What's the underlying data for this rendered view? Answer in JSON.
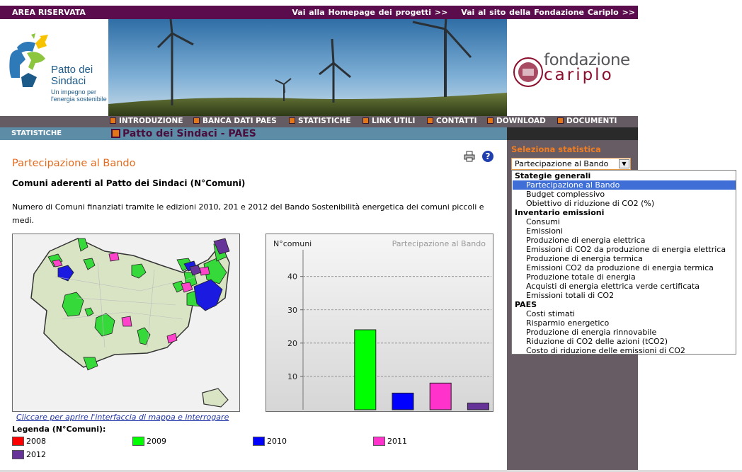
{
  "topbar": {
    "area_label": "AREA RISERVATA",
    "link_home": "Vai alla Homepage dei progetti >>",
    "link_site": "Vai al sito della Fondazione Cariplo >>"
  },
  "logos": {
    "left_name1": "Patto dei",
    "left_name2": "Sindaci",
    "left_tag1": "Un impegno per",
    "left_tag2": "l'energia sostenibile",
    "right_name1": "fondazione",
    "right_name2": "cariplo"
  },
  "nav": {
    "items": [
      "INTRODUZIONE",
      "BANCA DATI PAES",
      "STATISTICHE",
      "LINK UTILI",
      "CONTATTI",
      "DOWNLOAD",
      "DOCUMENTI"
    ]
  },
  "subbar": {
    "section": "STATISTICHE",
    "page_title": "Patto dei Sindaci - PAES"
  },
  "main": {
    "title": "Partecipazione al Bando",
    "subtitle": "Comuni aderenti al Patto dei Sindaci (N°Comuni)",
    "description": "Numero di Comuni finanziati tramite le edizioni 2010, 201 e 2012 del Bando Sostenibilità energetica dei comuni piccoli e medi.",
    "map_link": "Cliccare per aprire l'interfaccia di mappa e interrogare",
    "legend_title": "Legenda (N°Comuni):",
    "legend": [
      {
        "label": "2008",
        "color": "#ff0000"
      },
      {
        "label": "2009",
        "color": "#00ff00"
      },
      {
        "label": "2010",
        "color": "#0000ff"
      },
      {
        "label": "2011",
        "color": "#ff33cc"
      },
      {
        "label": "2012",
        "color": "#663399"
      }
    ]
  },
  "sidebar": {
    "title": "Seleziona statistica",
    "selected": "Partecipazione al Bando",
    "groups": [
      {
        "label": "Stategie generali",
        "options": [
          "Partecipazione al Bando",
          "Budget complessivo",
          "Obiettivo di riduzione di CO2 (%)"
        ]
      },
      {
        "label": "Inventario emissioni",
        "options": [
          "Consumi",
          "Emissioni",
          "Produzione di energia elettrica",
          "Emissioni di CO2 da produzione di energia elettrica",
          "Produzione di energia termica",
          "Emissioni CO2 da produzione di energia termica",
          "Produzione totale di energia",
          "Acquisti di energia elettrica verde certificata",
          "Emissioni totali di CO2"
        ]
      },
      {
        "label": "PAES",
        "options": [
          "Costi stimati",
          "Risparmio energetico",
          "Produzione di energia rinnovabile",
          "Riduzione di CO2 delle azioni (tCO2)",
          "Costo di riduzione delle emissioni di CO2"
        ]
      }
    ]
  },
  "chart_data": {
    "type": "bar",
    "title": "Partecipazione al Bando",
    "ylabel": "N°comuni",
    "xlabel": "",
    "categories": [
      "2008",
      "2009",
      "2010",
      "2011",
      "2012"
    ],
    "values": [
      0,
      24,
      5,
      8,
      2
    ],
    "colors": [
      "#ff0000",
      "#00ff00",
      "#0000ff",
      "#ff33cc",
      "#663399"
    ],
    "yticks": [
      10,
      20,
      30,
      40
    ],
    "ylim": [
      0,
      48
    ],
    "grid": true
  }
}
